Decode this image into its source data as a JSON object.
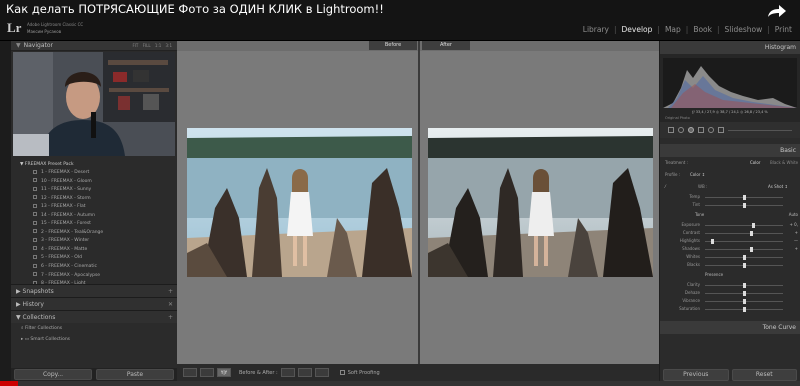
{
  "video_title": "Как делать ПОТРЯСАЮЩИЕ Фото за ОДИН КЛИК в Lightroom!!",
  "share_icon": "share-icon",
  "app": {
    "logo": "Lr",
    "name": "Adobe Lightroom Classic CC",
    "user": "Максим Русаков"
  },
  "modules": [
    {
      "label": "Library",
      "active": false
    },
    {
      "label": "Develop",
      "active": true
    },
    {
      "label": "Map",
      "active": false
    },
    {
      "label": "Book",
      "active": false
    },
    {
      "label": "Slideshow",
      "active": false
    },
    {
      "label": "Print",
      "active": false
    }
  ],
  "navigator": {
    "title": "Navigator",
    "options": "FIT FILL 1:1 3:1"
  },
  "presets": {
    "folder": "FREEMAX Preset Pack",
    "items": [
      "1 - FREEMAX - Desert",
      "10 - FREEMAX - Gloom",
      "11 - FREEMAX - Sunny",
      "12 - FREEMAX - Storm",
      "13 - FREEMAX - Flat",
      "14 - FREEMAX - Autumn",
      "15 - FREEMAX - Forest",
      "2 - FREEMAX - Teal&Orange",
      "3 - FREEMAX - Winter",
      "4 - FREEMAX - Matte",
      "5 - FREEMAX - Old",
      "6 - FREEMAX - Cinematic",
      "7 - FREEMAX - Apocalypse",
      "8 - FREEMAX - Light",
      "9 - FREEMAX - Dark"
    ]
  },
  "sections": {
    "snapshots": "Snapshots",
    "history": "History",
    "collections": "Collections",
    "filter": "Filter Collections",
    "smart": "Smart Collections"
  },
  "copy_label": "Copy...",
  "paste_label": "Paste",
  "before_label": "Before",
  "after_label": "After",
  "toolbar": {
    "mode": "Before & After :",
    "soft_proofing": "Soft Proofing"
  },
  "histogram": {
    "title": "Histogram",
    "readout": "ƒ/ 33,4 / 27,9   ◎ 38,7 / 24,1   ◎ 26,8 / 23,4 %",
    "original": "Original Photo"
  },
  "basic": {
    "title": "Basic",
    "treatment_label": "Treatment :",
    "color_label": "Color",
    "bw_label": "Black & White",
    "profile_label": "Profile :",
    "profile_value": "Color ↕",
    "wb_label": "WB :",
    "wb_value": "As Shot ↕",
    "tone_label": "Tone",
    "auto_label": "Auto",
    "presence_label": "Presence"
  },
  "sliders": {
    "wb": [
      {
        "label": "Temp",
        "pos": 0.5,
        "val": ""
      },
      {
        "label": "Tint",
        "pos": 0.5,
        "val": ""
      }
    ],
    "tone": [
      {
        "label": "Exposure",
        "pos": 0.62,
        "val": "+ 0,"
      },
      {
        "label": "Contrast",
        "pos": 0.6,
        "val": "+"
      },
      {
        "label": "Highlights",
        "pos": 0.1,
        "val": "—"
      },
      {
        "label": "Shadows",
        "pos": 0.6,
        "val": "+"
      },
      {
        "label": "Whites",
        "pos": 0.5,
        "val": ""
      },
      {
        "label": "Blacks",
        "pos": 0.5,
        "val": ""
      }
    ],
    "presence": [
      {
        "label": "Clarity",
        "pos": 0.5,
        "val": ""
      },
      {
        "label": "Dehaze",
        "pos": 0.5,
        "val": ""
      },
      {
        "label": "Vibrance",
        "pos": 0.5,
        "val": ""
      },
      {
        "label": "Saturation",
        "pos": 0.5,
        "val": ""
      }
    ]
  },
  "tone_curve_title": "Tone Curve",
  "previous_label": "Previous",
  "reset_label": "Reset",
  "video_progress": 0.022,
  "colors": {
    "progress": "#cc0000",
    "active_module": "#e8e8e8"
  }
}
